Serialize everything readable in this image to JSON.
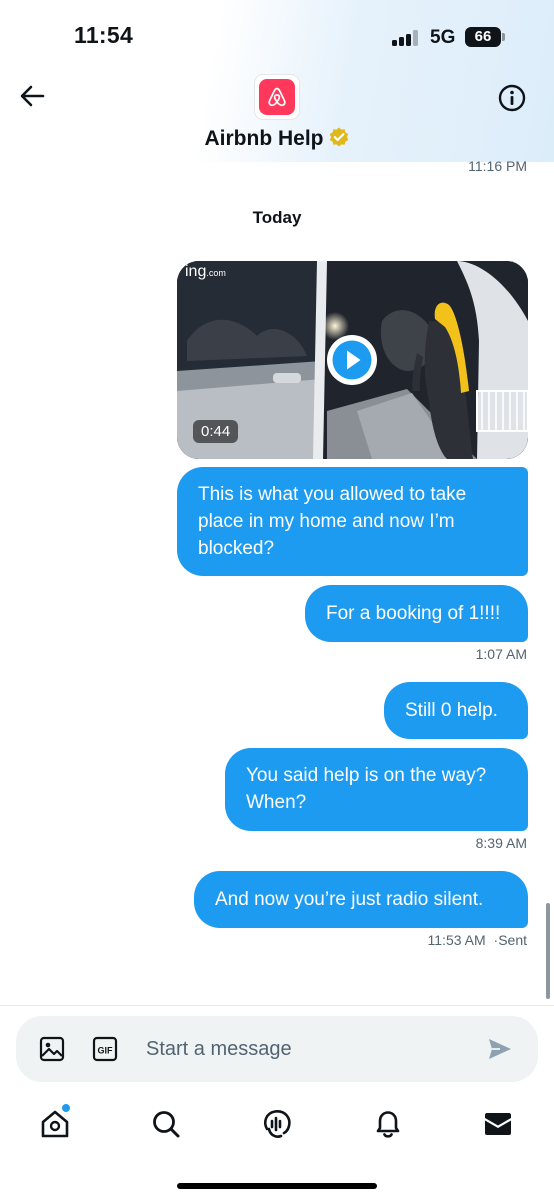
{
  "status_bar": {
    "time": "11:54",
    "network": "5G",
    "battery": "66"
  },
  "header": {
    "name": "Airbnb Help",
    "back_icon": "arrow-left-icon",
    "info_icon": "info-icon",
    "verified_icon": "verified-badge-icon"
  },
  "thread": {
    "previous_timestamp": "11:16 PM",
    "day_separator": "Today",
    "video": {
      "watermark": "ing",
      "watermark_suffix": ".com",
      "duration": "0:44",
      "play_icon": "play-icon"
    },
    "messages": [
      {
        "text": "This is what you allowed to take place in my home and now I’m blocked?"
      },
      {
        "text": "For a booking of 1!!!!",
        "timestamp": "1:07 AM"
      },
      {
        "text": "Still 0 help."
      },
      {
        "text": "You said help is on the way? When?",
        "timestamp": "8:39 AM"
      },
      {
        "text": "And now you’re just radio silent.",
        "timestamp": "11:53 AM",
        "status": "·Sent"
      }
    ]
  },
  "composer": {
    "placeholder": "Start a message",
    "media_icon": "image-icon",
    "gif_label": "GIF",
    "send_icon": "send-icon"
  },
  "tabs": [
    {
      "name": "home",
      "icon": "home-icon",
      "has_notification_dot": true
    },
    {
      "name": "search",
      "icon": "search-icon"
    },
    {
      "name": "spaces",
      "icon": "spaces-icon"
    },
    {
      "name": "notifications",
      "icon": "bell-icon"
    },
    {
      "name": "messages",
      "icon": "mail-icon",
      "active": true
    }
  ],
  "colors": {
    "accent": "#1d9bf0",
    "brand": "#ff385c",
    "text": "#0f1419",
    "muted": "#536471",
    "composer_bg": "#eff3f4"
  }
}
